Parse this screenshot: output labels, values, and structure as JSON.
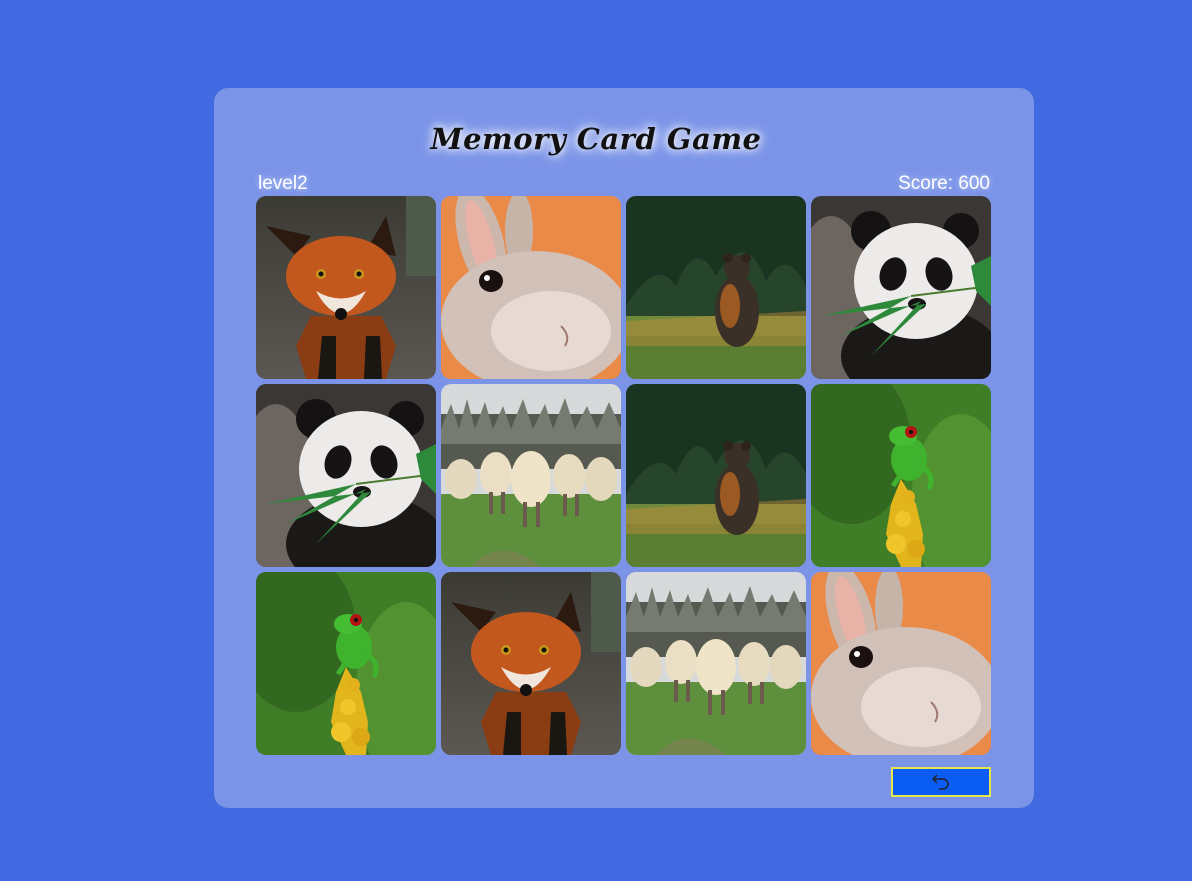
{
  "game": {
    "title": "Memory Card Game",
    "level": "level2",
    "score": "Score: 600"
  },
  "cards": [
    {
      "animal": "fox"
    },
    {
      "animal": "rabbit"
    },
    {
      "animal": "bear"
    },
    {
      "animal": "panda"
    },
    {
      "animal": "panda"
    },
    {
      "animal": "sheep"
    },
    {
      "animal": "bear"
    },
    {
      "animal": "frog"
    },
    {
      "animal": "frog"
    },
    {
      "animal": "fox"
    },
    {
      "animal": "sheep"
    },
    {
      "animal": "rabbit"
    }
  ],
  "controls": {
    "back_icon": "undo-arrow-icon"
  },
  "colors": {
    "background": "#4169e1",
    "panel": "#7b94e8",
    "button": "#0a5cf5",
    "button_border": "#e6e84a"
  }
}
